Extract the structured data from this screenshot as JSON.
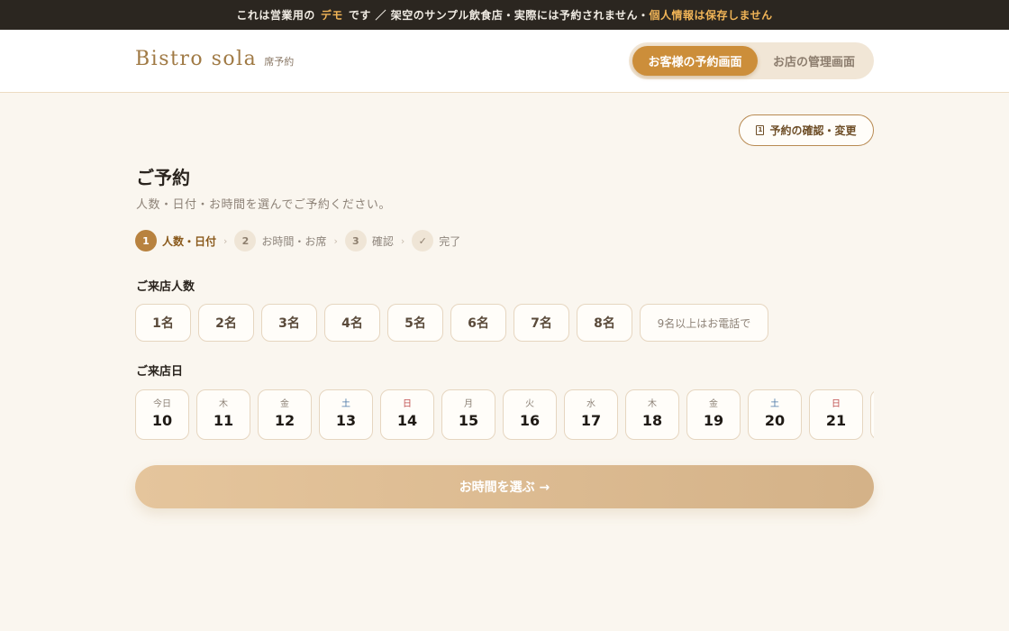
{
  "banner": {
    "text_a": "これは営業用の",
    "demo": "デモ",
    "text_b": "です ／ 架空のサンプル飲食店・実際には予約されません・",
    "privacy": "個人情報は保存しません"
  },
  "header": {
    "logo": "Bistro sola",
    "logo_sub": "席予約",
    "toggle": {
      "customer": "お客様の予約画面",
      "admin": "お店の管理画面"
    }
  },
  "confirm_button": {
    "icon": "document-icon",
    "label": "予約の確認・変更"
  },
  "page": {
    "title": "ご予約",
    "subtitle": "人数・日付・お時間を選んでご予約ください。"
  },
  "steps": [
    {
      "num": "1",
      "label": "人数・日付"
    },
    {
      "num": "2",
      "label": "お時間・お席"
    },
    {
      "num": "3",
      "label": "確認"
    },
    {
      "num": "✓",
      "label": "完了"
    }
  ],
  "party": {
    "label": "ご来店人数",
    "options": [
      "1名",
      "2名",
      "3名",
      "4名",
      "5名",
      "6名",
      "7名",
      "8名",
      "9名以上はお電話で"
    ]
  },
  "date": {
    "label": "ご来店日",
    "options": [
      {
        "dow": "今日",
        "day": "10"
      },
      {
        "dow": "木",
        "day": "11"
      },
      {
        "dow": "金",
        "day": "12"
      },
      {
        "dow": "土",
        "day": "13"
      },
      {
        "dow": "日",
        "day": "14"
      },
      {
        "dow": "月",
        "day": "15"
      },
      {
        "dow": "火",
        "day": "16"
      },
      {
        "dow": "水",
        "day": "17"
      },
      {
        "dow": "木",
        "day": "18"
      },
      {
        "dow": "金",
        "day": "19"
      },
      {
        "dow": "土",
        "day": "20"
      },
      {
        "dow": "日",
        "day": "21"
      },
      {
        "dow": "",
        "day": ""
      }
    ]
  },
  "next_button": "お時間を選ぶ →",
  "colors": {
    "accent": "#cc8e3a",
    "step_active": "#b8823f",
    "background": "#faf6ef",
    "banner_bg": "#2b2620",
    "banner_highlight": "#f0b457",
    "saturday": "#4a78a8",
    "sunday": "#c05050"
  }
}
